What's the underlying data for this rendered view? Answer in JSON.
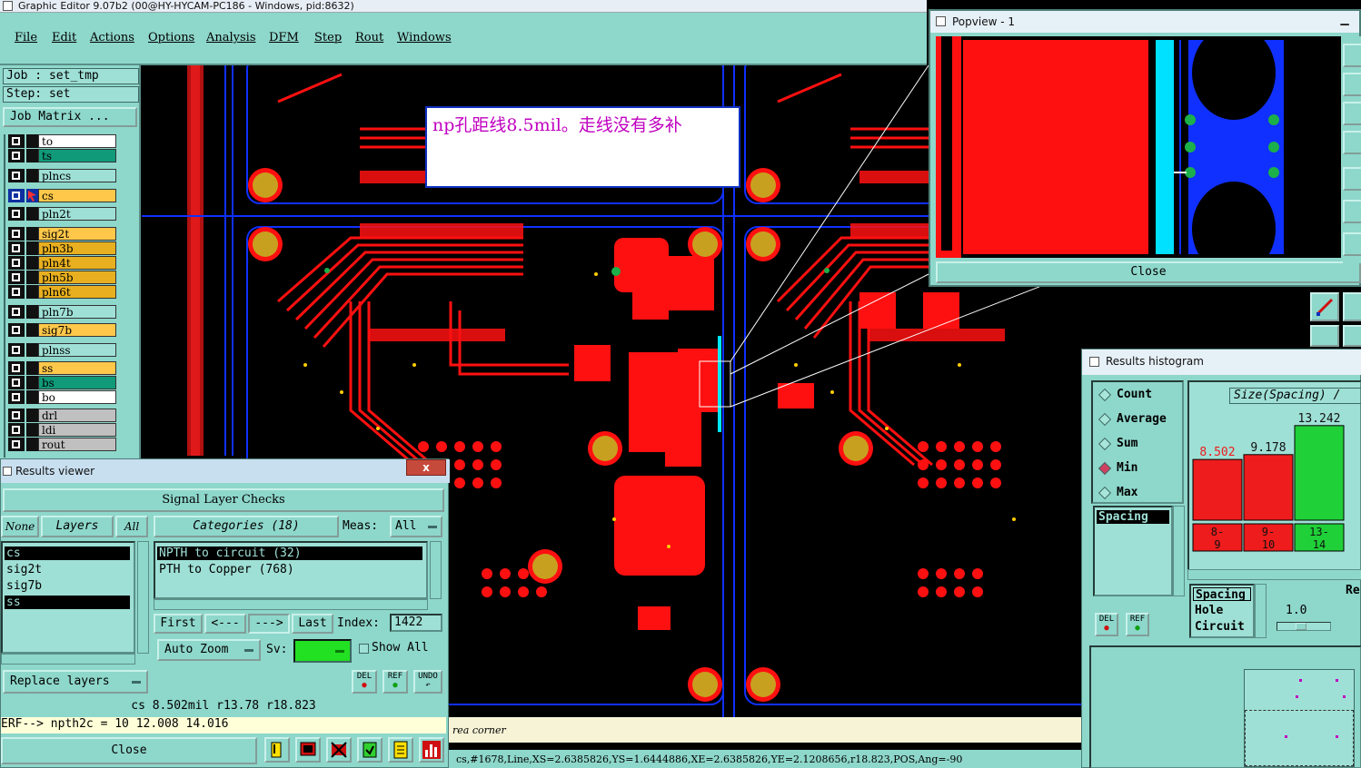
{
  "window": {
    "title": "Graphic Editor 9.07b2 (00@HY-HYCAM-PC186 - Windows, pid:8632)"
  },
  "menu": [
    "File",
    "Edit",
    "Actions",
    "Options",
    "Analysis",
    "DFM",
    "Step",
    "Rout",
    "Windows"
  ],
  "job": {
    "job_label": "Job : set_tmp",
    "step_label": "Step: set",
    "matrix_button": "Job Matrix ..."
  },
  "layers": [
    {
      "name": "to",
      "color": "#ffffff"
    },
    {
      "name": "ts",
      "color": "#109a7a"
    },
    {
      "name": "plncs",
      "color": "#9fe0d6"
    },
    {
      "name": "cs",
      "color": "#ffc84a"
    },
    {
      "name": "pln2t",
      "color": "#9fe0d6"
    },
    {
      "name": "sig2t",
      "color": "#ffc84a"
    },
    {
      "name": "pln3b",
      "color": "#e8b020"
    },
    {
      "name": "pln4t",
      "color": "#e8b020"
    },
    {
      "name": "pln5b",
      "color": "#e8b020"
    },
    {
      "name": "pln6t",
      "color": "#e8b020"
    },
    {
      "name": "pln7b",
      "color": "#9fe0d6"
    },
    {
      "name": "sig7b",
      "color": "#ffc84a"
    },
    {
      "name": "plnss",
      "color": "#9fe0d6"
    },
    {
      "name": "ss",
      "color": "#ffc84a"
    },
    {
      "name": "bs",
      "color": "#109a7a"
    },
    {
      "name": "bo",
      "color": "#ffffff"
    },
    {
      "name": "drl",
      "color": "#c0c0c0"
    },
    {
      "name": "ldi",
      "color": "#c0c0c0"
    },
    {
      "name": "rout",
      "color": "#c0c0c0"
    }
  ],
  "note": {
    "text": "np孔距线8.5mil。走线没有多补"
  },
  "results_viewer": {
    "title": "Results viewer",
    "close_x": "x",
    "header": "Signal Layer Checks",
    "none_btn": "None",
    "layers_btn": "Layers",
    "all_btn": "All",
    "categories_btn": "Categories (18)",
    "meas_label": "Meas:",
    "meas_value": "All",
    "layer_items": [
      {
        "name": "cs",
        "selected": true
      },
      {
        "name": "sig2t",
        "selected": false
      },
      {
        "name": "sig7b",
        "selected": false
      },
      {
        "name": "ss",
        "selected": true
      }
    ],
    "categories": [
      {
        "name": "NPTH to circuit (32)",
        "selected": true
      },
      {
        "name": "PTH to Copper (768)",
        "selected": false
      }
    ],
    "first_btn": "First",
    "prev_btn": "<---",
    "next_btn": "--->",
    "last_btn": "Last",
    "index_label": "Index:",
    "index_value": "1422",
    "autozoom_btn": "Auto Zoom",
    "sv_label": "Sv:",
    "showall_label": "Show All",
    "replace_btn": "Replace layers",
    "del_btn": "DEL",
    "ref_btn": "REF",
    "undo_btn": "UNDO",
    "measure_line": "cs 8.502mil   r13.78   r18.823",
    "ref_line": "ERF--> npth2c = 10 12.008 14.016",
    "close_btn": "Close"
  },
  "status": {
    "message": "rea corner",
    "info": "cs,#1678,Line,XS=2.6385826,YS=1.6444886,XE=2.6385826,YE=2.1208656,r18.823,POS,Ang=-90"
  },
  "popview": {
    "title": "Popview - 1",
    "close_btn": "Close"
  },
  "histogram": {
    "title": "Results histogram",
    "modes": [
      {
        "label": "Count",
        "selected": false
      },
      {
        "label": "Average",
        "selected": false
      },
      {
        "label": "Sum",
        "selected": false
      },
      {
        "label": "Min",
        "selected": true
      },
      {
        "label": "Max",
        "selected": false
      }
    ],
    "list_item": "Spacing",
    "del_btn": "DEL",
    "ref_btn": "REF",
    "chart_header": "Size(Spacing) /",
    "types": [
      "Spacing",
      "Hole",
      "Circuit"
    ],
    "re_label": "Re",
    "scale_value": "1.0"
  },
  "chart_data": {
    "type": "bar",
    "title": "Size(Spacing) /",
    "categories": [
      "8-9",
      "9-10",
      "13-14"
    ],
    "category_top": [
      "8-",
      "9-",
      "13-"
    ],
    "category_bottom": [
      "9",
      "10",
      "14"
    ],
    "values": [
      8.502,
      9.178,
      13.242
    ],
    "value_labels": [
      "8.502",
      "9.178",
      "13.242"
    ],
    "colors": [
      "#ee1c1c",
      "#ee1c1c",
      "#1fd038"
    ],
    "label_colors": [
      "#ee1c1c",
      "#111111",
      "#111111"
    ],
    "ylim": [
      0,
      15
    ]
  }
}
